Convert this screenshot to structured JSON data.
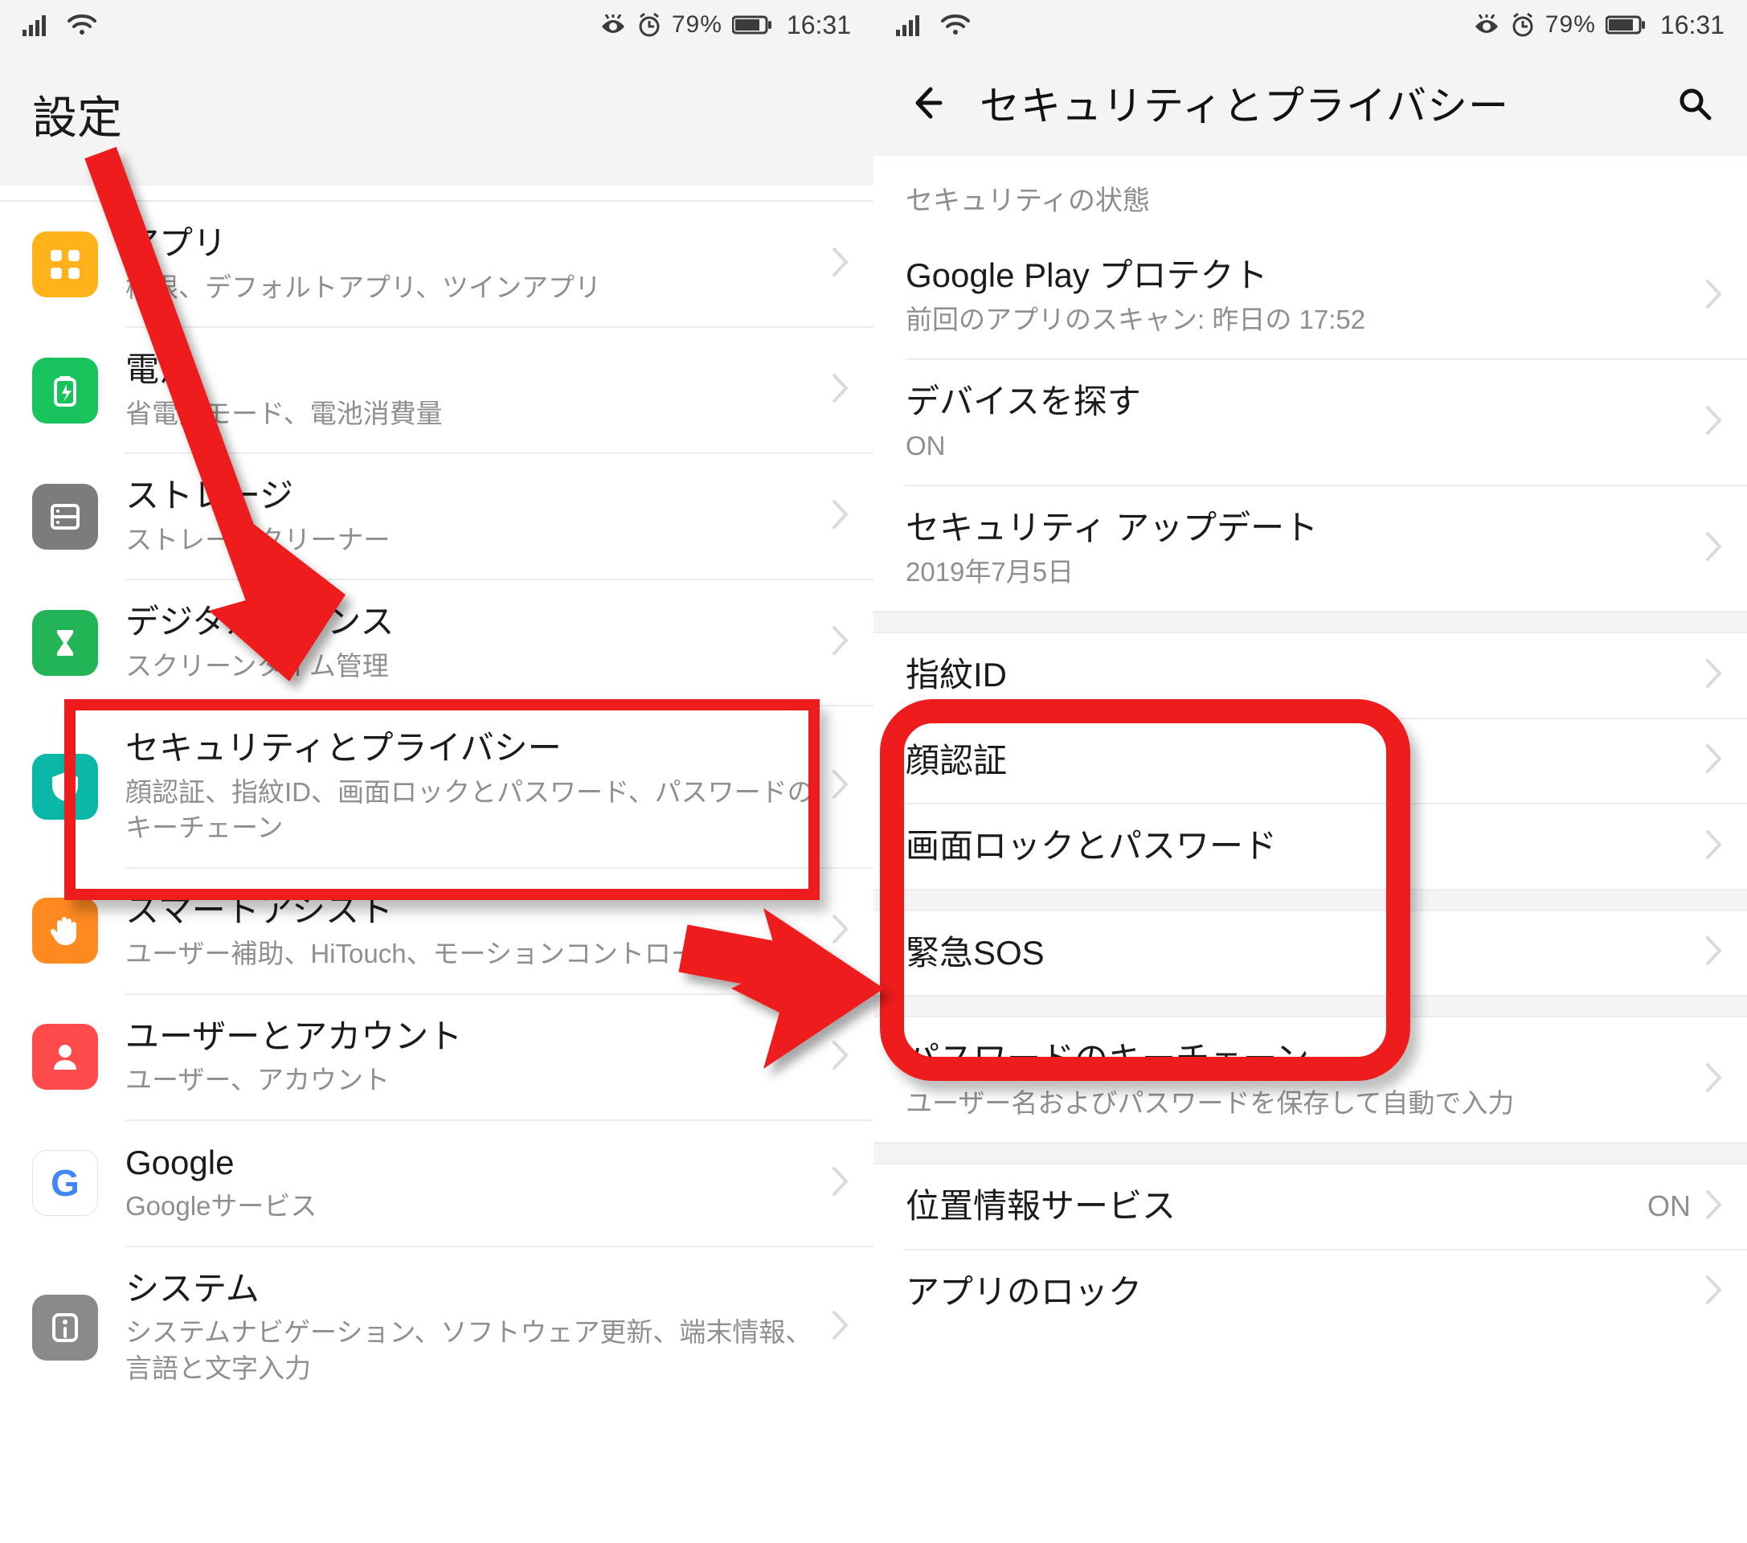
{
  "status": {
    "battery_pct": "79%",
    "time": "16:31"
  },
  "left": {
    "header_title": "設定",
    "rows": [
      {
        "icon": "apps",
        "title": "アプリ",
        "sub": "権限、デフォルトアプリ、ツインアプリ"
      },
      {
        "icon": "batt",
        "title": "電池",
        "sub": "省電力モード、電池消費量"
      },
      {
        "icon": "store",
        "title": "ストレージ",
        "sub": "ストレージクリーナー"
      },
      {
        "icon": "digi",
        "title": "デジタルバランス",
        "sub": "スクリーンタイム管理"
      },
      {
        "icon": "sec",
        "title": "セキュリティとプライバシー",
        "sub": "顔認証、指紋ID、画面ロックとパスワード、パスワードのキーチェーン"
      },
      {
        "icon": "smart",
        "title": "スマートアシスト",
        "sub": "ユーザー補助、HiTouch、モーションコントロール"
      },
      {
        "icon": "user",
        "title": "ユーザーとアカウント",
        "sub": "ユーザー、アカウント"
      },
      {
        "icon": "google",
        "title": "Google",
        "sub": "Googleサービス"
      },
      {
        "icon": "sys",
        "title": "システム",
        "sub": "システムナビゲーション、ソフトウェア更新、端末情報、言語と文字入力"
      }
    ]
  },
  "right": {
    "header_title": "セキュリティとプライバシー",
    "section1": "セキュリティの状態",
    "rows": [
      {
        "title": "Google Play プロテクト",
        "sub": "前回のアプリのスキャン: 昨日の 17:52"
      },
      {
        "title": "デバイスを探す",
        "sub": "ON"
      },
      {
        "title": "セキュリティ アップデート",
        "sub": "2019年7月5日"
      },
      {
        "title": "指紋ID"
      },
      {
        "title": "顔認証"
      },
      {
        "title": "画面ロックとパスワード"
      },
      {
        "title": "緊急SOS"
      },
      {
        "title": "パスワードのキーチェーン",
        "sub": "ユーザー名およびパスワードを保存して自動で入力"
      },
      {
        "title": "位置情報サービス",
        "value": "ON"
      },
      {
        "title": "アプリのロック"
      }
    ]
  }
}
